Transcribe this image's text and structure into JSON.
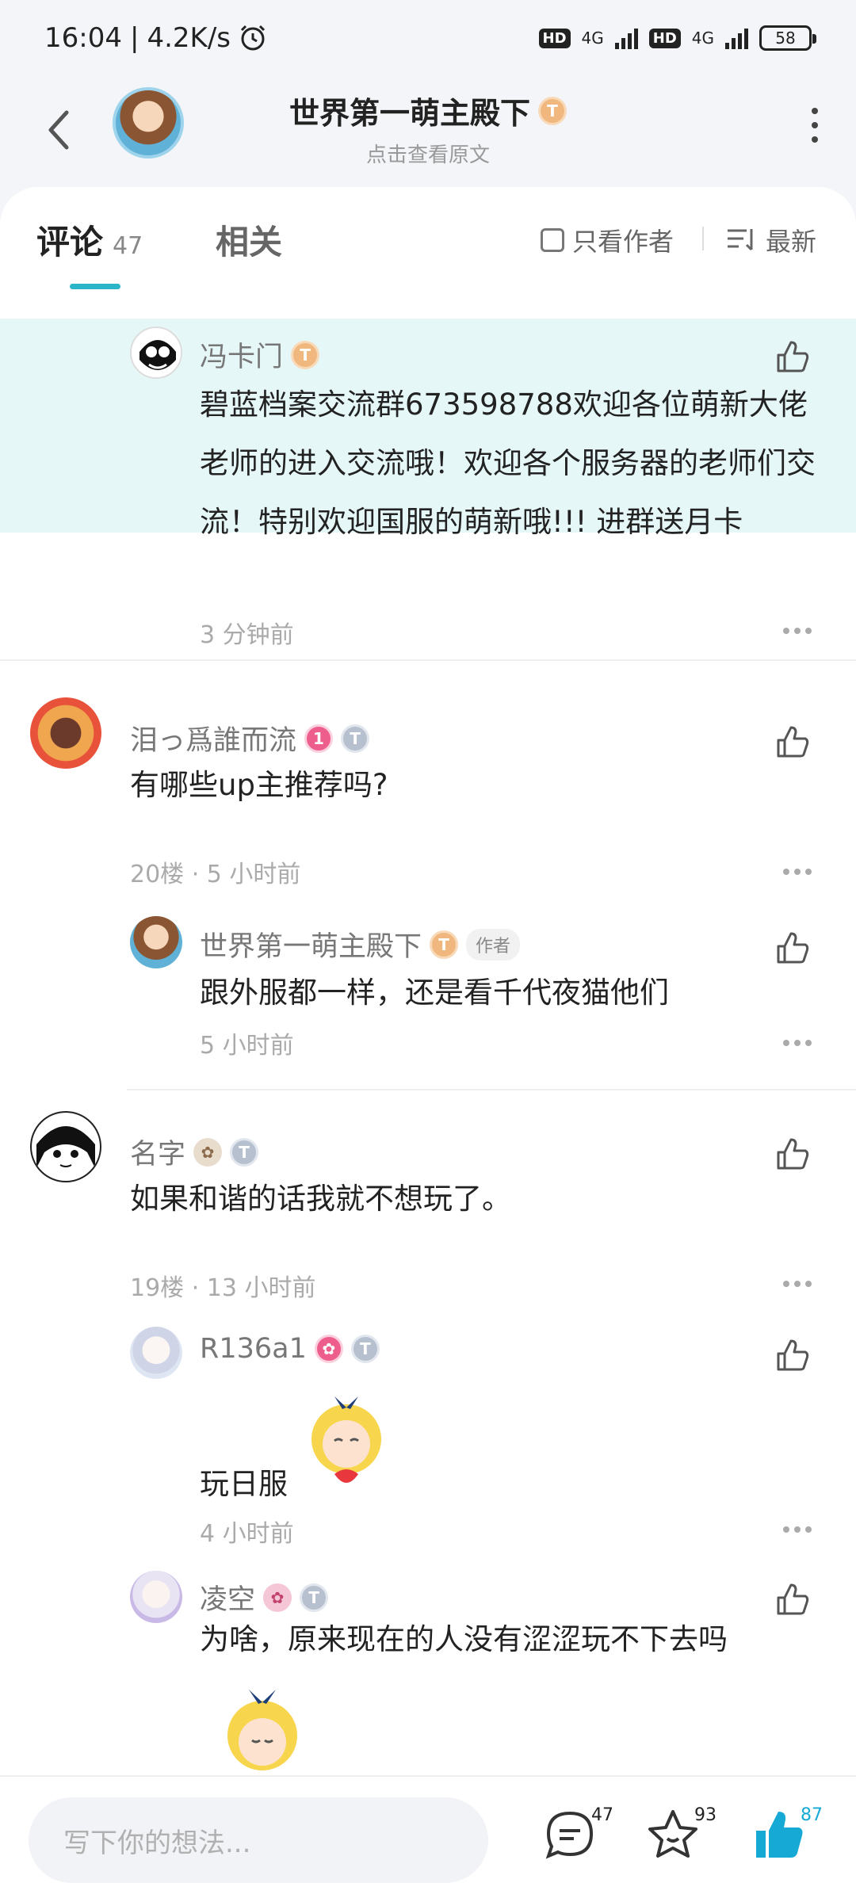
{
  "status": {
    "time": "16:04",
    "speed": "4.2K/s",
    "battery": "58",
    "net1": "4G",
    "net2": "4G",
    "hd": "HD"
  },
  "header": {
    "title": "世界第一萌主殿下",
    "subtitle": "点击查看原文",
    "level_badge": "T4"
  },
  "tabs": {
    "comments_label": "评论",
    "comments_count": "47",
    "related_label": "相关"
  },
  "filters": {
    "author_only": "只看作者",
    "sort": "最新"
  },
  "comments": [
    {
      "name": "冯卡门",
      "badge": "T4",
      "text": "碧蓝档案交流群673598788欢迎各位萌新大佬老师的进入交流哦！欢迎各个服务器的老师们交流！特别欢迎国服的萌新哦!!! 进群送月卡",
      "meta": "3 分钟前"
    },
    {
      "name": "泪っ爲誰而流",
      "badge": "T1",
      "text": "有哪些up主推荐吗?",
      "floor": "20楼",
      "time": "5 小时前"
    },
    {
      "name": "世界第一萌主殿下",
      "badge": "T4",
      "tag": "作者",
      "text": "跟外服都一样，还是看千代夜猫他们",
      "meta": "5 小时前"
    },
    {
      "name": "名字",
      "badge": "T1",
      "text": "如果和谐的话我就不想玩了。",
      "floor": "19楼",
      "time": "13 小时前"
    },
    {
      "name": "R136a1",
      "badge": "T2",
      "text": "玩日服",
      "meta": "4 小时前"
    },
    {
      "name": "凌空",
      "badge": "T1",
      "text": "为啥，原来现在的人没有涩涩玩不下去吗"
    }
  ],
  "bottom": {
    "placeholder": "写下你的想法...",
    "comment_count": "47",
    "fav_count": "93",
    "like_count": "87"
  },
  "colors": {
    "accent": "#2ab6c8",
    "highlight_bg": "#e6f7f8",
    "like_active": "#17a9d6"
  }
}
